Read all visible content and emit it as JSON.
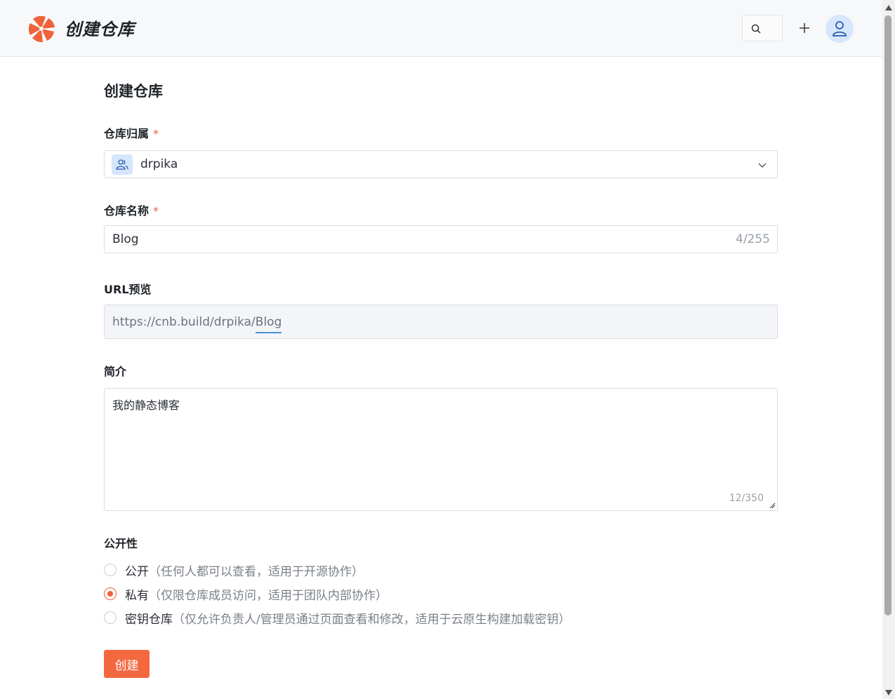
{
  "header": {
    "brand": "创建仓库"
  },
  "page": {
    "title": "创建仓库"
  },
  "form": {
    "owner": {
      "label": "仓库归属",
      "required_mark": "*",
      "value": "drpika"
    },
    "name": {
      "label": "仓库名称",
      "required_mark": "*",
      "value": "Blog",
      "count": "4/255"
    },
    "url": {
      "label": "URL预览",
      "prefix": "https://cnb.build/drpika/",
      "repo": "Blog"
    },
    "description": {
      "label": "简介",
      "value": "我的静态博客",
      "count": "12/350"
    },
    "visibility": {
      "label": "公开性",
      "options": [
        {
          "label": "公开",
          "desc": "（任何人都可以查看，适用于开源协作）",
          "checked": false
        },
        {
          "label": "私有",
          "desc": "（仅限仓库成员访问，适用于团队内部协作）",
          "checked": true
        },
        {
          "label": "密钥仓库",
          "desc": "（仅允许负责人/管理员通过页面查看和修改，适用于云原生构建加载密钥）",
          "checked": false
        }
      ]
    },
    "submit_label": "创建"
  },
  "colors": {
    "accent": "#f4683f",
    "link_underline": "#4a90d9"
  }
}
